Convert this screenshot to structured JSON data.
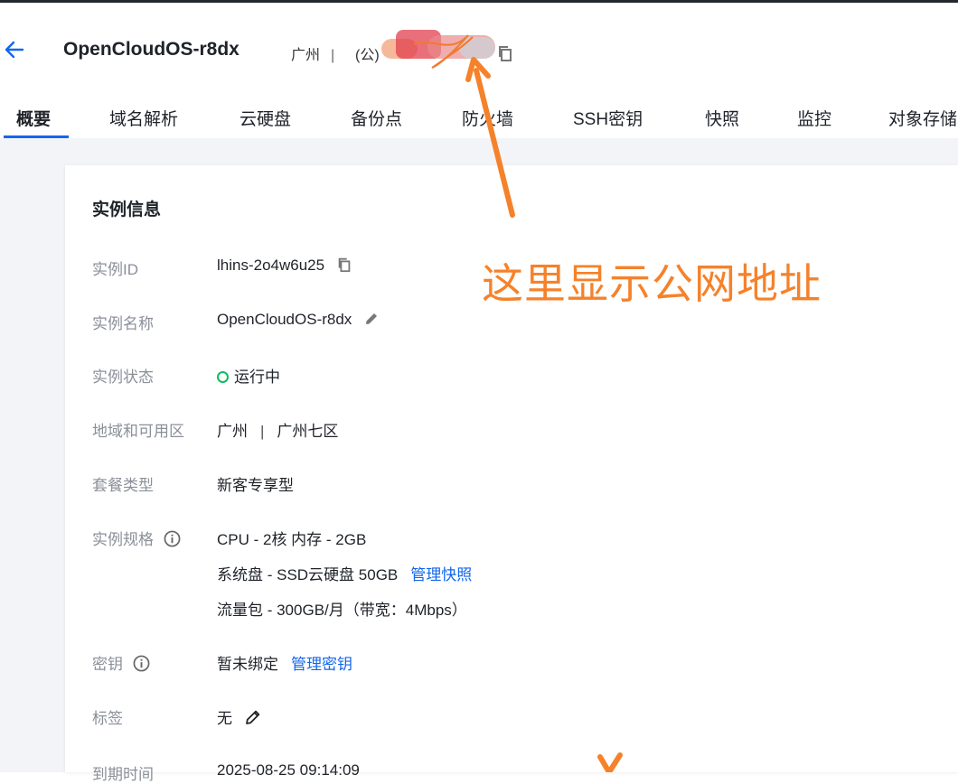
{
  "header": {
    "title": "OpenCloudOS-r8dx",
    "region": "广州",
    "ip_prefix": "(公)"
  },
  "tabs": [
    "概要",
    "域名解析",
    "云硬盘",
    "备份点",
    "防火墙",
    "SSH密钥",
    "快照",
    "监控",
    "对象存储"
  ],
  "card": {
    "title": "实例信息",
    "rows": {
      "id": {
        "label": "实例ID",
        "value": "lhins-2o4w6u25"
      },
      "name": {
        "label": "实例名称",
        "value": "OpenCloudOS-r8dx"
      },
      "status": {
        "label": "实例状态",
        "value": "运行中"
      },
      "zone": {
        "label": "地域和可用区",
        "region": "广州",
        "zone": "广州七区"
      },
      "package": {
        "label": "套餐类型",
        "value": "新客专享型"
      },
      "spec": {
        "label": "实例规格",
        "cpu_mem": "CPU - 2核 内存 - 2GB",
        "disk": "系统盘 - SSD云硬盘 50GB",
        "disk_link": "管理快照",
        "traffic": "流量包 - 300GB/月（带宽：4Mbps）"
      },
      "key": {
        "label": "密钥",
        "value": "暂未绑定",
        "link": "管理密钥"
      },
      "tag": {
        "label": "标签",
        "value": "无"
      },
      "expire": {
        "label": "到期时间",
        "value": "2025-08-25 09:14:09"
      }
    }
  },
  "annotation": {
    "text": "这里显示公网地址",
    "color": "#f5822a"
  },
  "colors": {
    "accent": "#1366ec",
    "status_green": "#0abf5b"
  }
}
